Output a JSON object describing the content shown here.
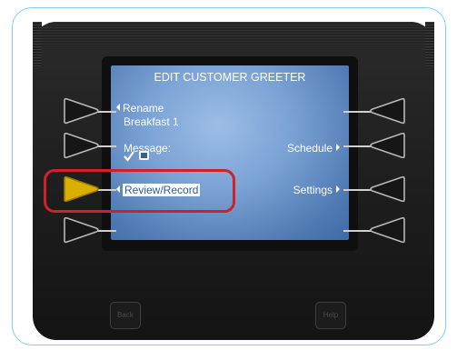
{
  "screen": {
    "title": "EDIT CUSTOMER GREETER",
    "rename_label": "Rename",
    "rename_value": "Breakfast 1",
    "message_label": "Message:",
    "review_record_label": "Review/Record",
    "schedule_label": "Schedule",
    "settings_label": "Settings"
  },
  "hardware": {
    "left_soft_key": "Back",
    "right_soft_key": "Help"
  },
  "colors": {
    "screen_blue": "#6f97cc",
    "highlight_key": "#d9b000",
    "callout_red": "#d0202a",
    "frame_border": "#7ed3ea"
  }
}
